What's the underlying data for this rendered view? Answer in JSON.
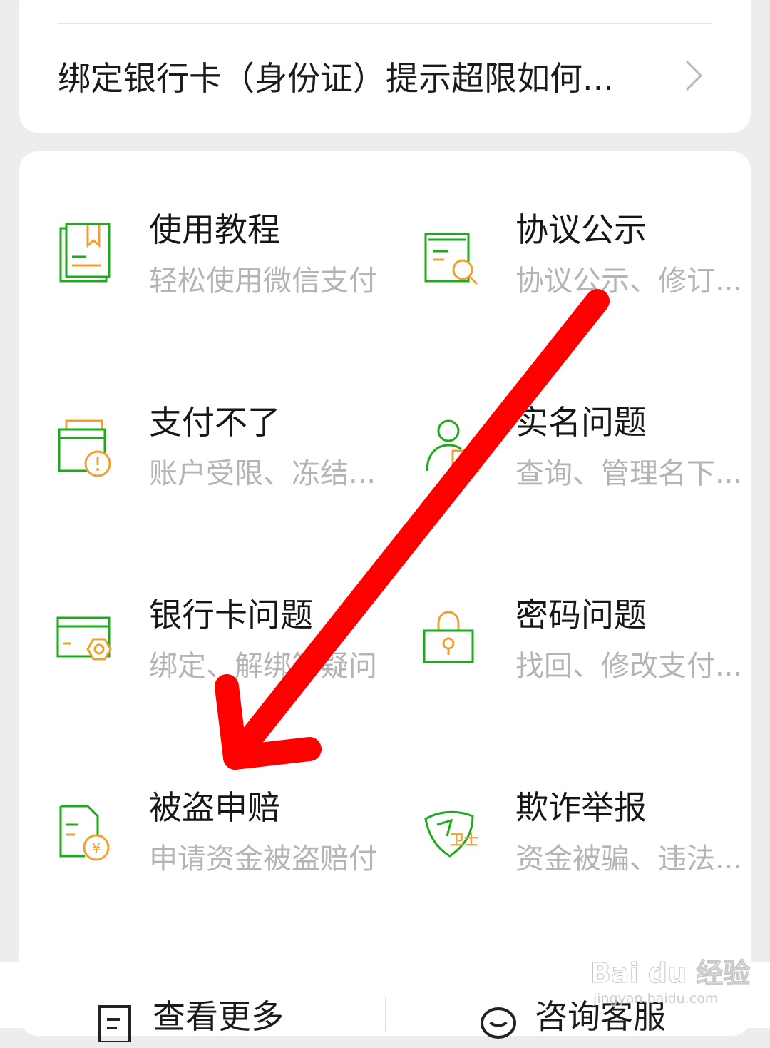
{
  "top_card": {
    "faq_item": "绑定银行卡（身份证）提示超限如何..."
  },
  "grid": {
    "items": [
      {
        "title": "使用教程",
        "subtitle": "轻松使用微信支付",
        "icon": "tutorial-book-icon"
      },
      {
        "title": "协议公示",
        "subtitle": "协议公示、修订...",
        "icon": "agreement-search-icon"
      },
      {
        "title": "支付不了",
        "subtitle": "账户受限、冻结...",
        "icon": "payment-warning-icon"
      },
      {
        "title": "实名问题",
        "subtitle": "查询、管理名下...",
        "icon": "realname-user-icon"
      },
      {
        "title": "银行卡问题",
        "subtitle": "绑定、解绑等疑问",
        "icon": "bank-card-icon"
      },
      {
        "title": "密码问题",
        "subtitle": "找回、修改支付...",
        "icon": "password-lock-icon"
      },
      {
        "title": "被盗申赔",
        "subtitle": "申请资金被盗赔付",
        "icon": "theft-claim-icon"
      },
      {
        "title": "欺诈举报",
        "subtitle": "资金被骗、违法...",
        "icon": "fraud-shield-icon"
      }
    ]
  },
  "bottom_bar": {
    "more_label": "查看更多",
    "service_label": "咨询客服"
  },
  "watermark": {
    "main": "Bai du 经验",
    "sub": "jingyan.baidu.com"
  },
  "colors": {
    "green": "#1aad19",
    "orange": "#f0a030",
    "arrow_red": "#ff0000"
  }
}
